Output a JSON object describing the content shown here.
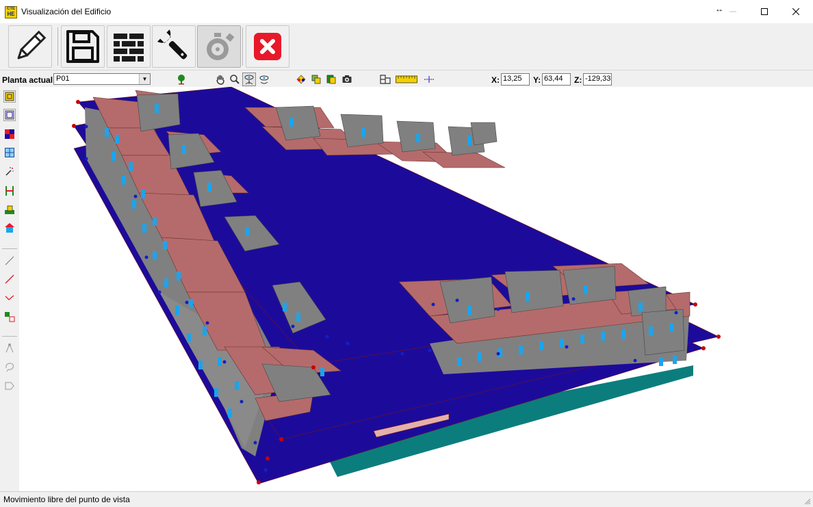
{
  "window": {
    "title": "Visualización del Edificio",
    "app_icon_top": "CTE",
    "app_icon_bottom": "HE",
    "resize_glyph": "↔"
  },
  "main_toolbar": [
    {
      "name": "edit-button",
      "icon": "pencil-icon"
    },
    {
      "name": "save-button",
      "icon": "floppy-disk-icon"
    },
    {
      "name": "materials-button",
      "icon": "brick-wall-icon"
    },
    {
      "name": "settings-button",
      "icon": "wrench-icon"
    },
    {
      "name": "timer-button",
      "icon": "stopwatch-icon",
      "state": "pressed-disabled"
    },
    {
      "name": "close-tool-button",
      "icon": "red-x-icon"
    }
  ],
  "secondary_toolbar": {
    "planta_label": "Planta actual",
    "planta_value": "P01",
    "x_label": "X:",
    "x_value": "13,25",
    "y_label": "Y:",
    "y_value": "63,44",
    "z_label": "Z:",
    "z_value": "-129,33"
  },
  "status": {
    "text": "Movimiento libre del punto de vista"
  },
  "colors": {
    "slab": "#1c0b9b",
    "wall_grey": "#808080",
    "roof_pink": "#b56b6b",
    "window_blue": "#1ca4ec",
    "ground_teal": "#0c7d7d",
    "node_red": "#c80000",
    "node_blue": "#1020c8"
  }
}
